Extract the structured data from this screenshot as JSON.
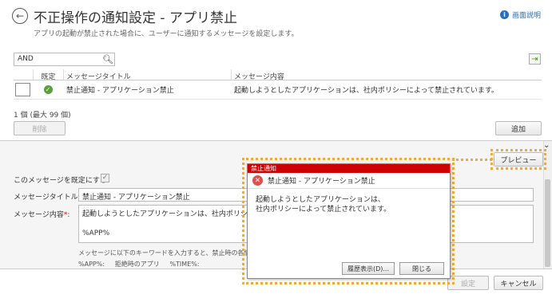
{
  "header": {
    "title": "不正操作の通知設定 - アプリ禁止",
    "description": "アプリの起動が禁止された場合に、ユーザーに通知するメッセージを設定します。",
    "help_label": "画面説明"
  },
  "search": {
    "value": "AND"
  },
  "table": {
    "columns": [
      "既定",
      "メッセージタイトル",
      "メッセージ内容"
    ],
    "rows": [
      {
        "title": "禁止通知 - アプリケーション禁止",
        "content": "起動しようとしたアプリケーションは、社内ポリシーによって禁止されています。"
      }
    ]
  },
  "count_text": "1 個 (最大 99 個)",
  "buttons": {
    "delete": "削除",
    "add": "追加",
    "preview": "プレビュー",
    "settings": "設定",
    "cancel": "キャンセル"
  },
  "form": {
    "default_label": "このメッセージを既定にする:",
    "title_label": "メッセージタイトル:",
    "title_value": "禁止通知 - アプリケーション禁止",
    "content_label": "メッセージ内容",
    "content_line1": "起動しようとしたアプリケーションは、社内ポリシーによって禁",
    "content_line2": "%APP%",
    "hint_line1": "メッセージに以下のキーワードを入力すると、禁止時の各情報に置",
    "hint_line2": "%APP%:     拒絶時のアプリ     %TIME%:"
  },
  "dialog": {
    "window_title": "禁止通知",
    "header": "禁止通知 - アプリケーション禁止",
    "body_line1": "起動しようとしたアプリケーションは、",
    "body_line2": "社内ポリシーによって禁止されています。",
    "history_button": "履歴表示(D)...",
    "close_button": "閉じる"
  },
  "colors": {
    "highlight": "#f0a93c",
    "dialog_title_bg": "#cc0000",
    "accent": "#2a6ebb"
  },
  "icons": [
    "back-arrow-icon",
    "info-icon",
    "search-icon",
    "export-icon",
    "ok-check-icon",
    "error-icon",
    "collapse-chevron-icon"
  ]
}
